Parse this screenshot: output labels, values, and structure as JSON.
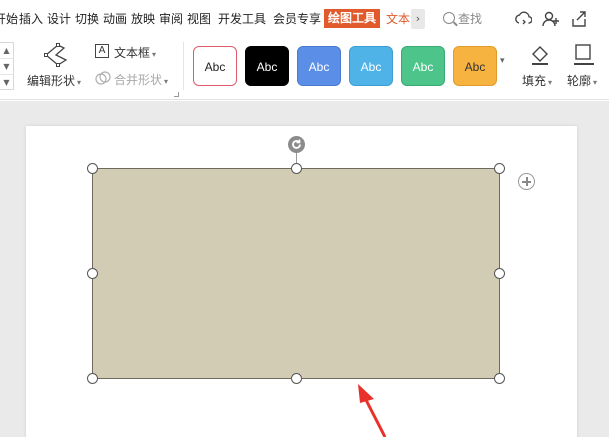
{
  "menu": {
    "tabs": [
      "开始",
      "插入",
      "设计",
      "切换",
      "动画",
      "放映",
      "审阅",
      "视图",
      "开发工具",
      "会员专享",
      "绘图工具",
      "文本"
    ],
    "first_tab_visible": "开始",
    "active_tab": "绘图工具",
    "more_label": "›",
    "search_label": "查找"
  },
  "ribbon": {
    "spin_up": "▲",
    "spin_down": "▼",
    "edit_shape_label": "编辑形状",
    "textbox_label": "文本框",
    "merge_shape_label": "合并形状",
    "dropdown_caret": "▾",
    "textbox_icon_text": "A",
    "swatch_text": "Abc",
    "swatch_colors": [
      "#ffffff",
      "#000000",
      "#5b8ee6",
      "#4fb3e8",
      "#4dc48a",
      "#f7b340"
    ],
    "swatch_border_colors": [
      "#e05a6a",
      "#000000",
      "#4a7bd0",
      "#3d9ed4",
      "#3aaa74",
      "#e09b2a"
    ],
    "swatch_text_colors": [
      "#222222",
      "#ffffff",
      "#ffffff",
      "#ffffff",
      "#ffffff",
      "#333333"
    ],
    "fill_label": "填充",
    "outline_label": "轮廓"
  },
  "canvas": {
    "shape_fill": "#d3ccb4",
    "arrow_color": "#e8312b"
  }
}
